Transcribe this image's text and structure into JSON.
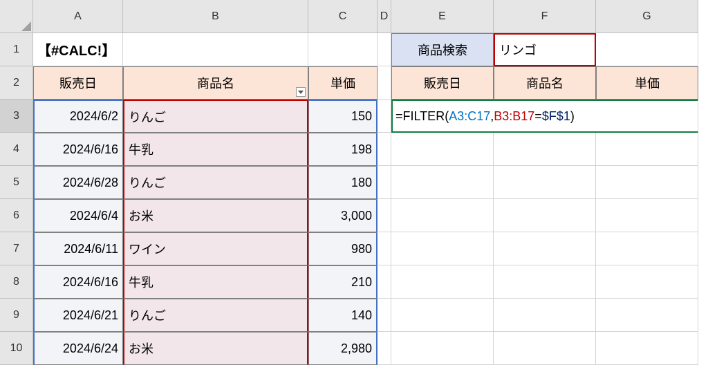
{
  "columns": [
    "A",
    "B",
    "C",
    "D",
    "E",
    "F",
    "G"
  ],
  "rows": [
    "1",
    "2",
    "3",
    "4",
    "5",
    "6",
    "7",
    "8",
    "9",
    "10"
  ],
  "title_cell": "【#CALC!】",
  "headers_left": {
    "date": "販売日",
    "product": "商品名",
    "price": "単価"
  },
  "search_label": "商品検索",
  "search_value": "リンゴ",
  "headers_right": {
    "date": "販売日",
    "product": "商品名",
    "price": "単価"
  },
  "formula": {
    "eq": "=",
    "fn": "FILTER",
    "open": "(",
    "arg1": "A3:C17",
    "comma1": ",",
    "arg2": "B3:B17",
    "eqop": "=",
    "arg3": "$F$1",
    "close": ")"
  },
  "data": [
    {
      "date": "2024/6/2",
      "product": "りんご",
      "price": "150"
    },
    {
      "date": "2024/6/16",
      "product": "牛乳",
      "price": "198"
    },
    {
      "date": "2024/6/28",
      "product": "りんご",
      "price": "180"
    },
    {
      "date": "2024/6/4",
      "product": "お米",
      "price": "3,000"
    },
    {
      "date": "2024/6/11",
      "product": "ワイン",
      "price": "980"
    },
    {
      "date": "2024/6/16",
      "product": "牛乳",
      "price": "210"
    },
    {
      "date": "2024/6/21",
      "product": "りんご",
      "price": "140"
    },
    {
      "date": "2024/6/24",
      "product": "お米",
      "price": "2,980"
    }
  ]
}
